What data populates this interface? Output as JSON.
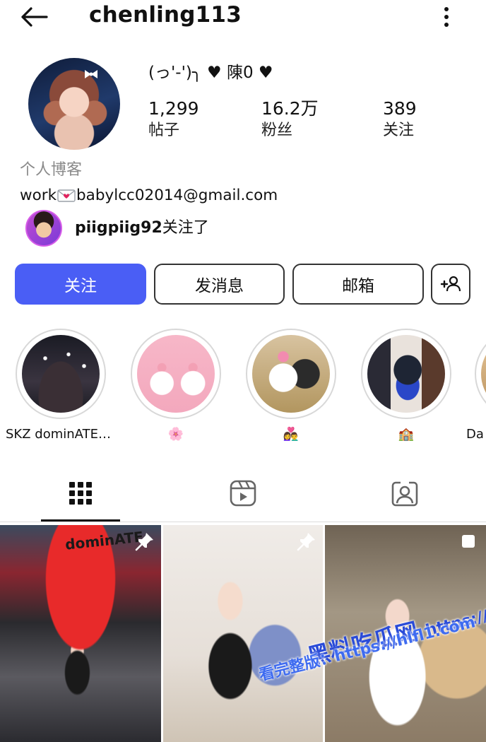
{
  "header": {
    "username": "chenling113",
    "back_icon": "arrow-left-icon",
    "more_icon": "more-vertical-icon"
  },
  "profile": {
    "display_name": "(っ'-')╮ ♥ 陳0 ♥",
    "stats": [
      {
        "value": "1,299",
        "label": "帖子"
      },
      {
        "value": "16.2万",
        "label": "粉丝"
      },
      {
        "value": "389",
        "label": "关注"
      }
    ],
    "category": "个人博客",
    "bio_prefix": "work",
    "bio_icon": "love-letter-emoji",
    "bio_email": "babylcc02014@gmail.com",
    "followed_by_user": "piigpiig92",
    "followed_by_suffix": "关注了"
  },
  "actions": {
    "follow": "关注",
    "message": "发消息",
    "email": "邮箱",
    "add_user_icon": "add-person-icon"
  },
  "highlights": [
    {
      "label": "SKZ dominATE…"
    },
    {
      "label": "🌸"
    },
    {
      "label": "👩‍❤️‍👨"
    },
    {
      "label": "🏫"
    },
    {
      "label": "Da"
    }
  ],
  "tabs": [
    {
      "icon": "grid-icon",
      "active": true
    },
    {
      "icon": "reels-icon",
      "active": false
    },
    {
      "icon": "tagged-icon",
      "active": false
    }
  ],
  "posts": [
    {
      "badge_icon": "pin-icon",
      "poster_text": "dominATE"
    },
    {
      "badge_icon": "pin-icon"
    },
    {
      "badge_icon": "multi-image-icon"
    }
  ],
  "watermark": {
    "line1": "黑料吃瓜网",
    "line1_url": "https://hlfl1.com",
    "line2": "看完整版：https://hlfl1.com"
  },
  "colors": {
    "follow_button": "#4a5ef5",
    "muted_text": "#8a8a8a"
  }
}
